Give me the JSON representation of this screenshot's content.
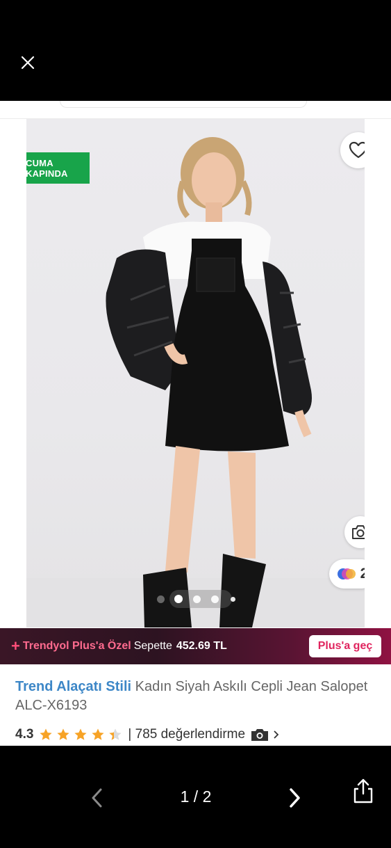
{
  "viewer": {
    "page_counter": "1 / 2"
  },
  "product": {
    "delivery_badge": "CUMA\nKAPINDA",
    "delivery_line1": "CUMA",
    "delivery_line2": "KAPINDA",
    "variant_count": "2",
    "image_dots": 4,
    "active_dot": 1
  },
  "plus_banner": {
    "label": "Trendyol Plus'a Özel",
    "text": "Sepette",
    "price": "452.69 TL",
    "button": "Plus'a geç"
  },
  "title": {
    "brand": "Trend Alaçatı Stili",
    "name": "Kadın Siyah Askılı Cepli Jean Salopet ALC-X6193"
  },
  "rating": {
    "value": "4.3",
    "stars": 4.3,
    "reviews": "| 785 değerlendirme"
  },
  "colors": {
    "delivery_green": "#18a44a",
    "brand_blue": "#3d87c7",
    "star_orange": "#f7a326",
    "plus_pink": "#e0245e"
  },
  "icons": [
    "close-icon",
    "truck-icon",
    "heart-icon",
    "camera-icon",
    "color-variants-icon",
    "star-icon",
    "chevron-left-icon",
    "chevron-right-icon",
    "share-icon"
  ]
}
